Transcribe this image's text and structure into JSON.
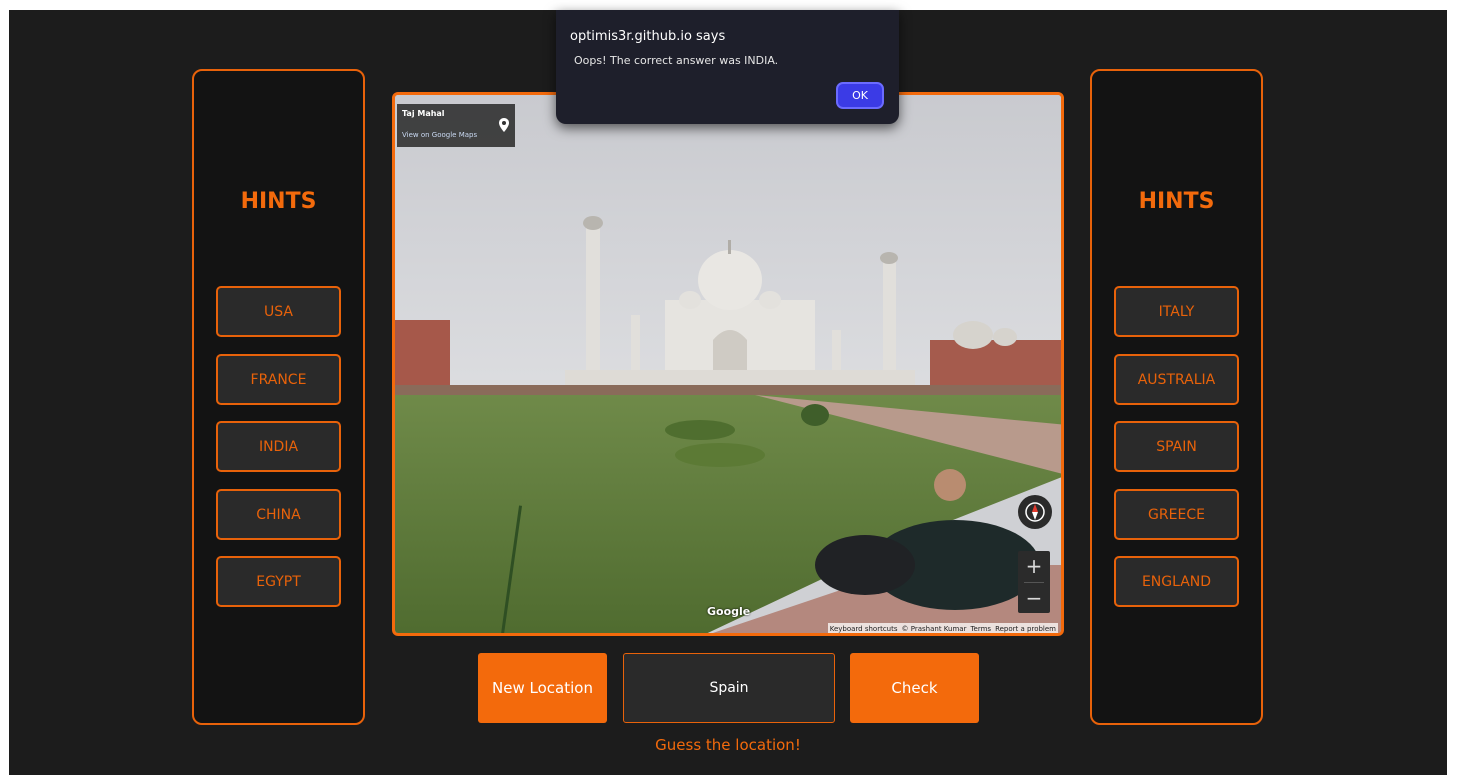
{
  "app": {
    "left_panel": {
      "title": "HINTS",
      "hints": [
        "USA",
        "FRANCE",
        "INDIA",
        "CHINA",
        "EGYPT"
      ]
    },
    "right_panel": {
      "title": "HINTS",
      "hints": [
        "ITALY",
        "AUSTRALIA",
        "SPAIN",
        "GREECE",
        "ENGLAND"
      ]
    },
    "viewer": {
      "place_name": "Taj Mahal",
      "place_link": "View on Google Maps",
      "google_logo": "Google",
      "attribution": [
        "Keyboard shortcuts",
        "© Prashant Kumar",
        "Terms",
        "Report a problem"
      ],
      "zoom_in": "+",
      "zoom_out": "−"
    },
    "controls": {
      "new_location": "New Location",
      "guess_value": "Spain",
      "check": "Check"
    },
    "status": "Guess the location!"
  },
  "dialog": {
    "title": "optimis3r.github.io says",
    "message": "Oops! The correct answer was INDIA.",
    "ok": "OK"
  },
  "colors": {
    "accent": "#f36a0c",
    "background": "#1c1c1c",
    "dialog_ok": "#3b3be6"
  }
}
